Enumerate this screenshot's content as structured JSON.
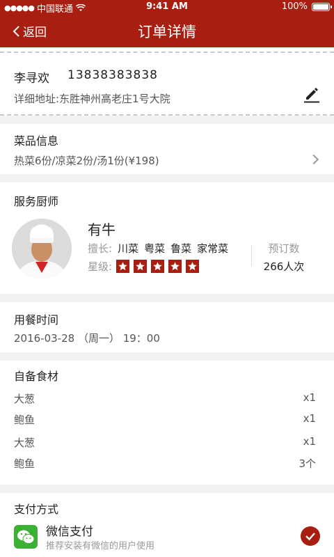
{
  "status_bar": {
    "carrier": "中国联通",
    "time": "9:41 AM",
    "battery": "100%"
  },
  "nav": {
    "back_label": "返回",
    "title": "订单详情"
  },
  "address": {
    "name": "李寻欢",
    "phone": "13838383838",
    "detail": "详细地址:东胜神州高老庄1号大院"
  },
  "dishes": {
    "title": "菜品信息",
    "summary": "热菜6份/凉菜2份/汤1份(¥198)"
  },
  "chef": {
    "title": "服务厨师",
    "name": "有牛",
    "specialty_label": "擅长:",
    "specialties": [
      "川菜",
      "粤菜",
      "鲁菜",
      "家常菜"
    ],
    "rating_label": "星级:",
    "rating": 5,
    "orders_label": "预订数",
    "orders_value": "266人次"
  },
  "meal_time": {
    "title": "用餐时间",
    "value": "2016-03-28 （周一） 19：00"
  },
  "ingredients": {
    "title": "自备食材",
    "items": [
      {
        "name": "大葱",
        "qty": "x1"
      },
      {
        "name": "鲍鱼",
        "qty": "x1"
      },
      {
        "name": "大葱",
        "qty": "x1"
      },
      {
        "name": "鲍鱼",
        "qty": "3个"
      }
    ]
  },
  "payment": {
    "title": "支付方式",
    "method_name": "微信支付",
    "method_desc": "推荐安装有微信的用户使用",
    "selected": true
  },
  "colors": {
    "brand": "#a81e10",
    "wechat": "#3cb034"
  }
}
